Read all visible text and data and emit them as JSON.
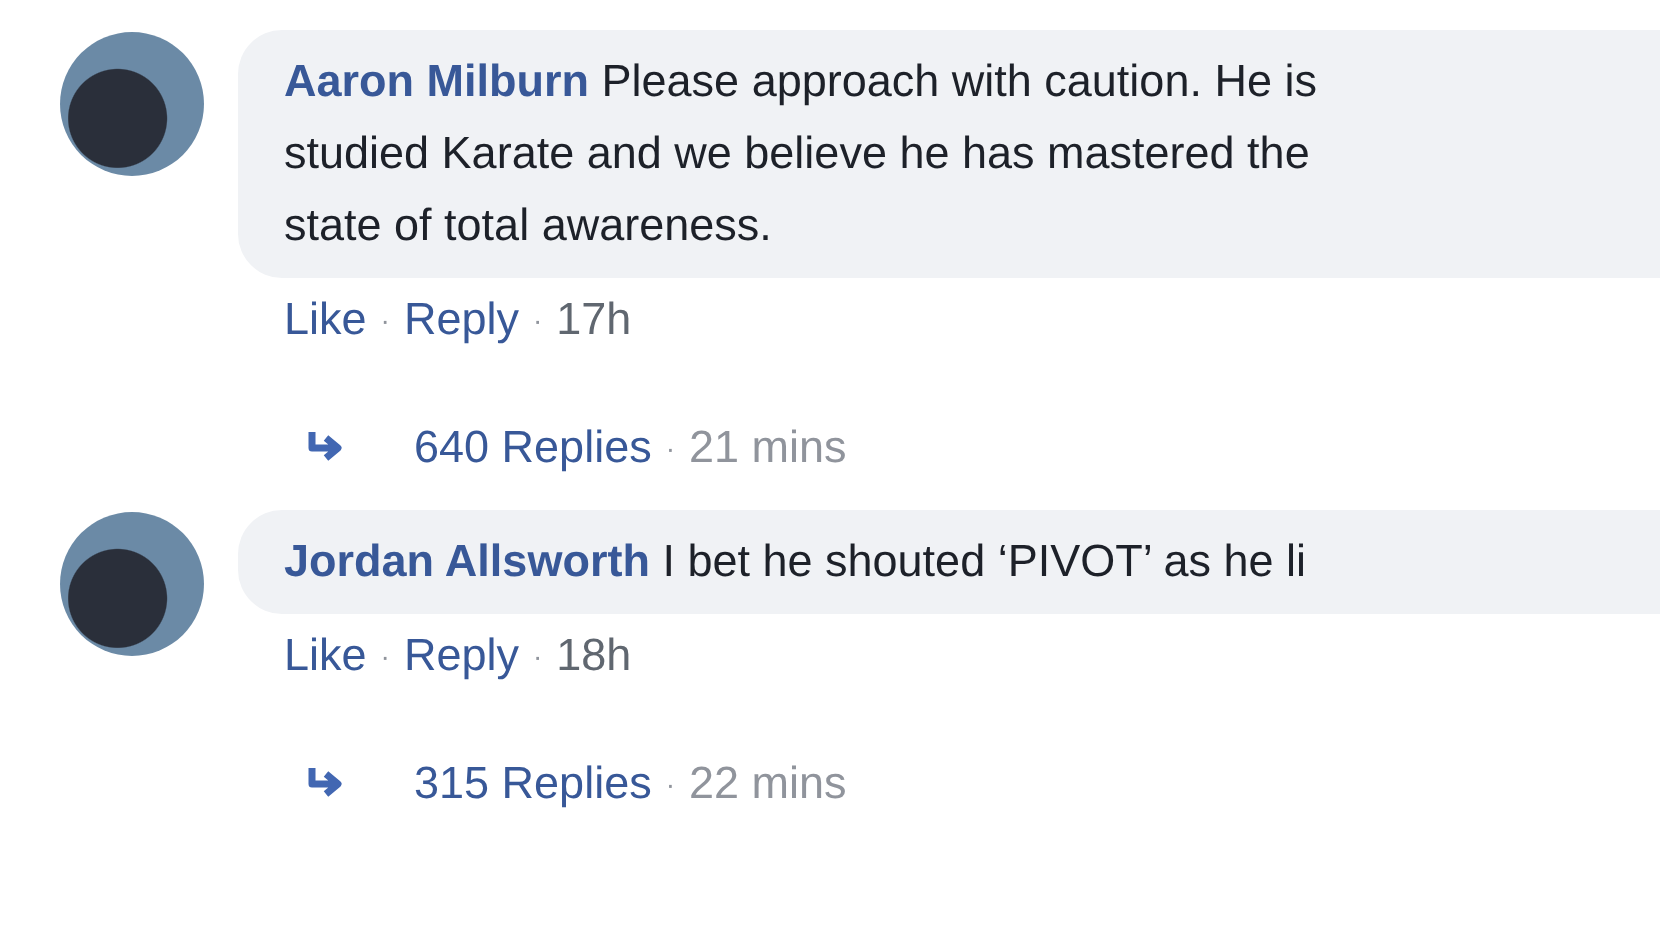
{
  "comments": [
    {
      "author": "Aaron Milburn",
      "lines": [
        "Please approach with caution. He is",
        "studied Karate and we believe he has mastered the",
        "state of total awareness."
      ],
      "actions": [
        "Like",
        "Reply"
      ],
      "time": "17h",
      "separator": "·",
      "replies": {
        "count": "640 Replies",
        "separator": "·",
        "time": "21 mins"
      }
    },
    {
      "author": "Jordan Allsworth",
      "lines": [
        "I bet he shouted ‘PIVOT’ as he li"
      ],
      "actions": [
        "Like",
        "Reply"
      ],
      "time": "18h",
      "separator": "·",
      "replies": {
        "count": "315 Replies",
        "separator": "·",
        "time": "22 mins"
      }
    }
  ]
}
